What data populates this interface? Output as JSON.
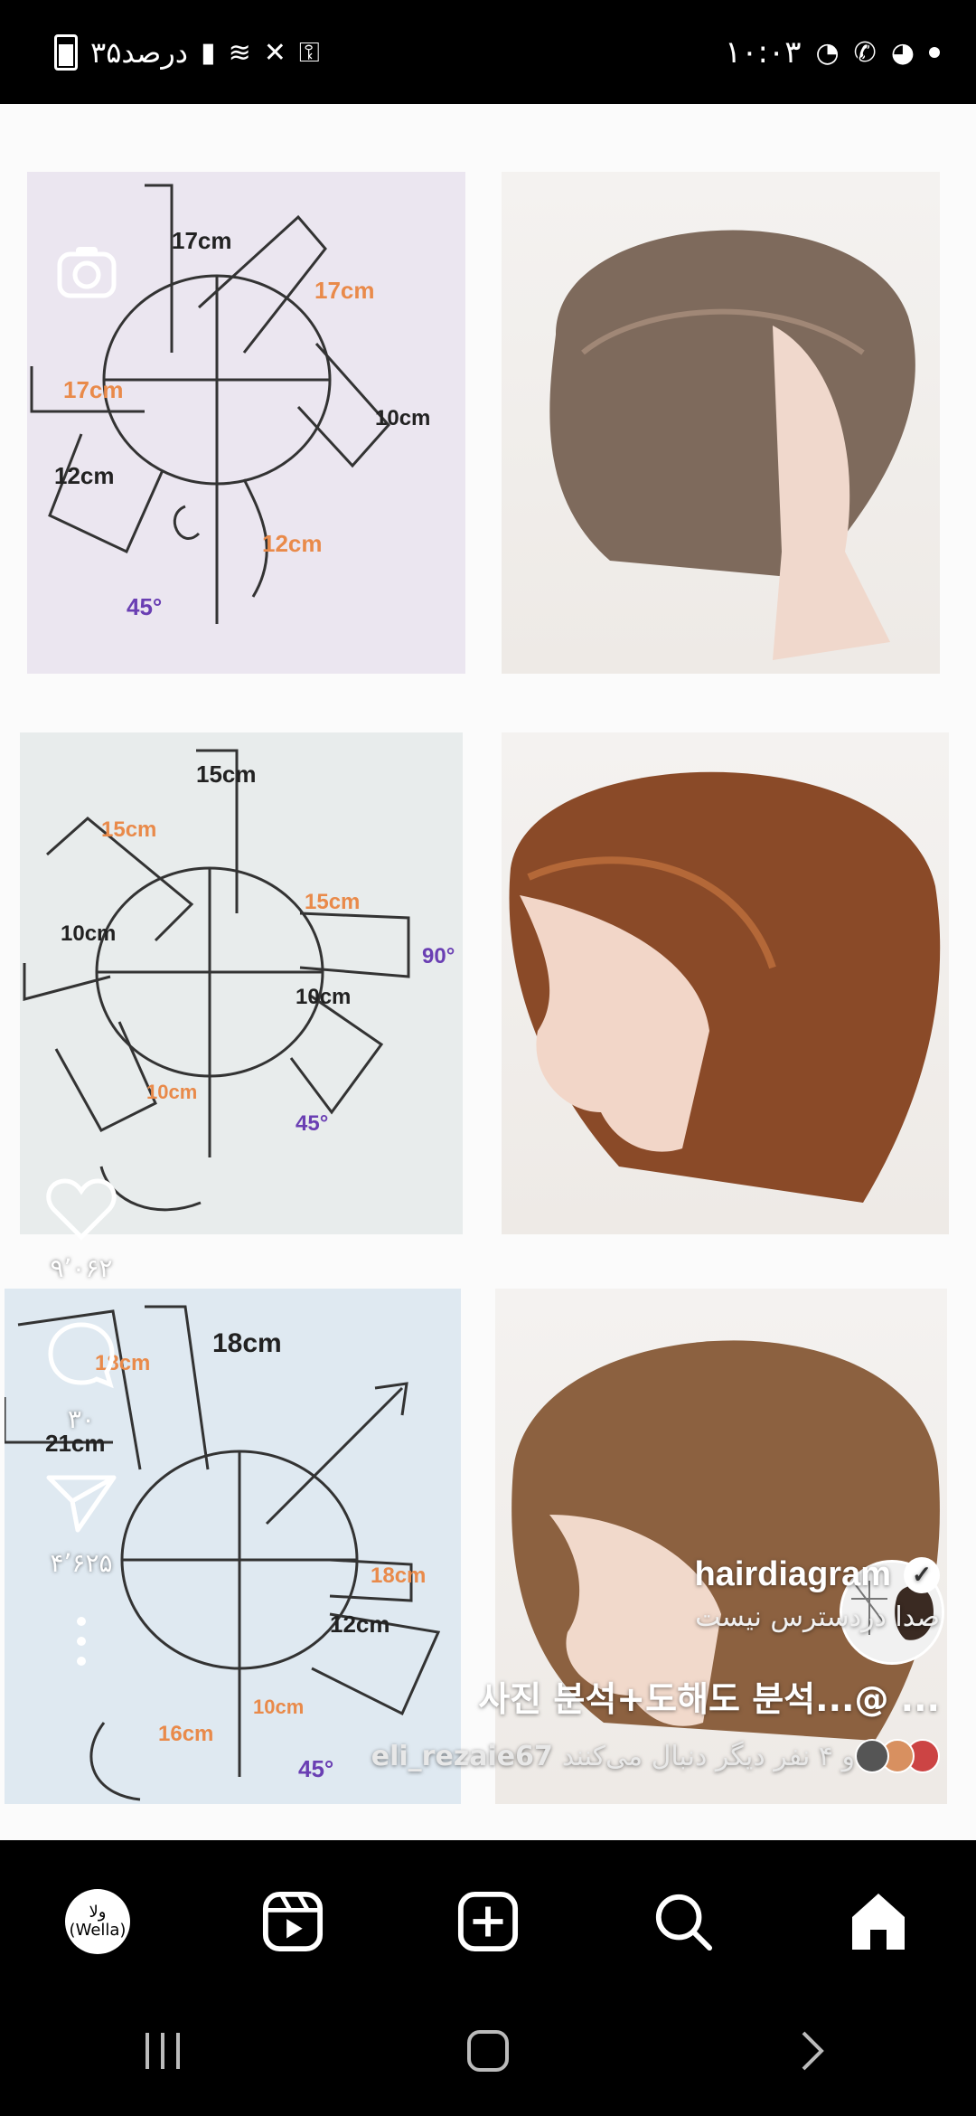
{
  "status_bar": {
    "time": "۱۰:۰۳",
    "battery_text": "۳۵درصد"
  },
  "post": {
    "diagram_labels": {
      "d1": [
        "17cm",
        "17cm",
        "17cm",
        "10cm",
        "12cm",
        "12cm",
        "45°"
      ],
      "d2": [
        "15cm",
        "15cm",
        "15cm",
        "10cm",
        "10cm",
        "10cm",
        "90°",
        "45°"
      ],
      "d3": [
        "18cm",
        "18cm",
        "21cm",
        "18cm",
        "12cm",
        "16cm",
        "10cm",
        "45°"
      ]
    }
  },
  "actions": {
    "likes": "۹٬۰۶۲",
    "comments": "۳۰",
    "shares": "۴٬۶۲۵"
  },
  "caption": {
    "username": "hairdiagram",
    "audio": "صدا دردسترس نیست",
    "text": "사진 분석+도해도 분석...@ ...",
    "follow_text": "و ۴ نفر دیگر دنبال می‌کنند",
    "follow_user": "eli_rezaie67"
  },
  "nav": {
    "profile_label": "ولا (Wella)"
  },
  "colors": {
    "accent_orange": "#e98a4a",
    "bg": "#000000"
  }
}
